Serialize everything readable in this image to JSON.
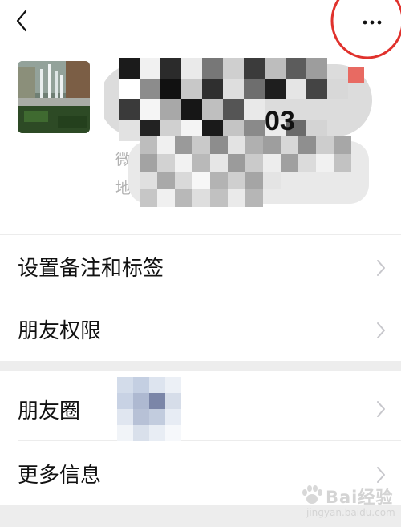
{
  "header": {
    "back_icon": "chevron-left-icon",
    "more_icon": "ellipsis-icon",
    "annotation_color": "#e0322d"
  },
  "profile": {
    "name_visible_suffix": "03",
    "id_label_fragment": "微",
    "region_label_fragment": "地"
  },
  "menu": {
    "set_remark_tags": "设置备注和标签",
    "friend_permissions": "朋友权限",
    "moments": "朋友圈",
    "more_info": "更多信息"
  },
  "watermark": {
    "brand": "Bai经验",
    "url": "jingyan.baidu.com"
  }
}
